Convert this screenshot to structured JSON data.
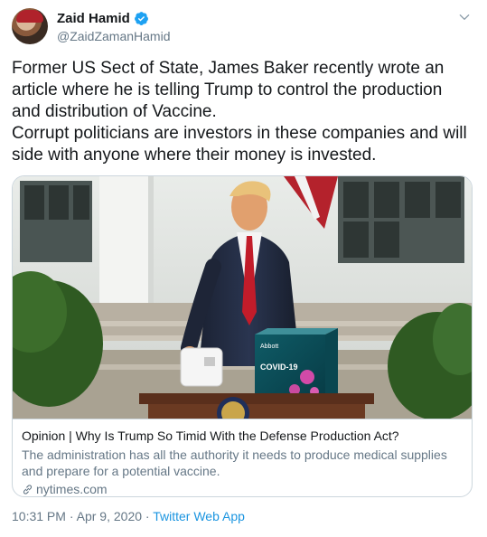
{
  "author": {
    "name": "Zaid Hamid",
    "handle": "@ZaidZamanHamid"
  },
  "tweet": {
    "lines": [
      "Former US Sect of State, James Baker recently wrote an article where he is telling Trump to control the production and distribution of Vaccine.",
      "Corrupt politicians are investors in these companies and will side with anyone where their money is invested."
    ]
  },
  "card": {
    "title": "Opinion | Why Is Trump So Timid With the Defense Production Act?",
    "description": "The administration has all the authority it needs to produce medical supplies and prepare for a potential vaccine.",
    "domain": "nytimes.com",
    "box_brand": "Abbott",
    "box_label": "COVID-19"
  },
  "meta": {
    "time": "10:31 PM",
    "separator": "·",
    "date": "Apr 9, 2020",
    "app": "Twitter Web App"
  },
  "colors": {
    "link": "#1b95e0",
    "secondary_text": "#657786",
    "verified": "#1da1f2",
    "border": "#ccd6dd"
  },
  "icons": [
    "verified-badge-icon",
    "chevron-down-icon",
    "link-icon"
  ]
}
